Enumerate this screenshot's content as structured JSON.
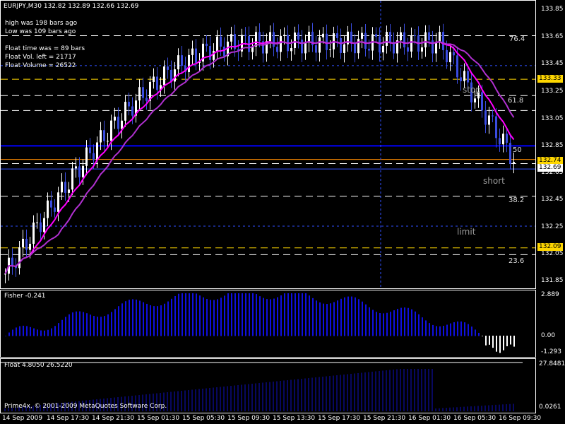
{
  "header": {
    "symbol_line": "EURJPY,M30  132.82 132.89 132.66 132.69",
    "high_was": "high was   198  bars ago",
    "low_was": "Low was   109  bars ago",
    "float_time": "Float time was  =       89 bars",
    "float_vol_left": "Float Vol. left    =      21717",
    "float_volume": "Float Volume    =      26522"
  },
  "fib_labels": {
    "f764": "76.4",
    "f618": "61.8",
    "f50": "50",
    "f382": "38.2",
    "f236": "23.6"
  },
  "annotations": {
    "stop": "stop",
    "short": "short",
    "limit": "limit"
  },
  "price_axis": [
    "133.85",
    "133.65",
    "133.45",
    "133.25",
    "133.05",
    "132.85",
    "132.65",
    "132.45",
    "132.25",
    "132.05",
    "131.85"
  ],
  "price_tags": {
    "t1": {
      "text": "133.33",
      "color": "#ffd700"
    },
    "t2": {
      "text": "132.74",
      "color": "#ffd700"
    },
    "t3": {
      "text": "132.69",
      "color": "#ffffff"
    },
    "t4": {
      "text": "132.09",
      "color": "#ffd700"
    }
  },
  "fisher": {
    "title": "Fisher -0.241",
    "axis": [
      "2.889",
      "0.00",
      "-1.293"
    ]
  },
  "float_ind": {
    "title": "Float 4.8050 26.5220",
    "axis": [
      "27.8481",
      "0.0261"
    ]
  },
  "copyright": "Prime4x, © 2001-2009 MetaQuotes Software Corp.",
  "time_axis": [
    "14 Sep 2009",
    "14 Sep 17:30",
    "14 Sep 21:30",
    "15 Sep 01:30",
    "15 Sep 05:30",
    "15 Sep 09:30",
    "15 Sep 13:30",
    "15 Sep 17:30",
    "15 Sep 21:30",
    "16 Sep 01:30",
    "16 Sep 05:30",
    "16 Sep 09:30"
  ],
  "colors": {
    "bull": "#ffffff",
    "bear": "#3a4ce0",
    "ma_fast": "#ff00ff",
    "ma_slow": "#b030d0",
    "blue_line": "#0000ff",
    "dash_white": "#ffffff",
    "dash_yellow": "#ffd700",
    "dash_orange": "#ff8c00",
    "fisher": "#1010e0"
  }
}
